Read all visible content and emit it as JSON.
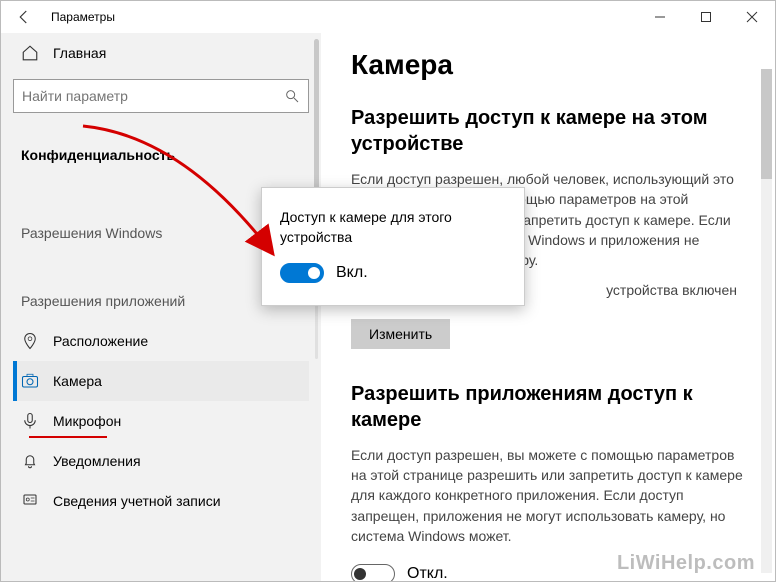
{
  "window": {
    "title": "Параметры"
  },
  "sidebar": {
    "home": "Главная",
    "search_placeholder": "Найти параметр",
    "section_current": "Конфиденциальность",
    "heading_windows": "Разрешения Windows",
    "heading_apps": "Разрешения приложений",
    "items": [
      {
        "label": "Расположение"
      },
      {
        "label": "Камера"
      },
      {
        "label": "Микрофон"
      },
      {
        "label": "Уведомления"
      },
      {
        "label": "Сведения учетной записи"
      }
    ]
  },
  "content": {
    "heading": "Камера",
    "section1_title": "Разрешить доступ к камере на этом устройстве",
    "section1_body": "Если доступ разрешен, любой человек, использующий это устройство, сможет с помощью параметров на этой странице разрешить или запретить доступ к камере. Если доступ запрещен, система Windows и приложения не смогут использовать камеру.",
    "status_line": "устройства включен",
    "change_btn": "Изменить",
    "section2_title": "Разрешить приложениям доступ к камере",
    "section2_body": "Если доступ разрешен, вы можете с помощью параметров на этой странице разрешить или запретить доступ к камере для каждого конкретного приложения. Если доступ запрещен, приложения не могут использовать камеру, но система Windows может.",
    "toggle2_label": "Откл."
  },
  "popup": {
    "text": "Доступ к камере для этого устройства",
    "toggle_label": "Вкл."
  },
  "watermark": "LiWiHelp.com"
}
